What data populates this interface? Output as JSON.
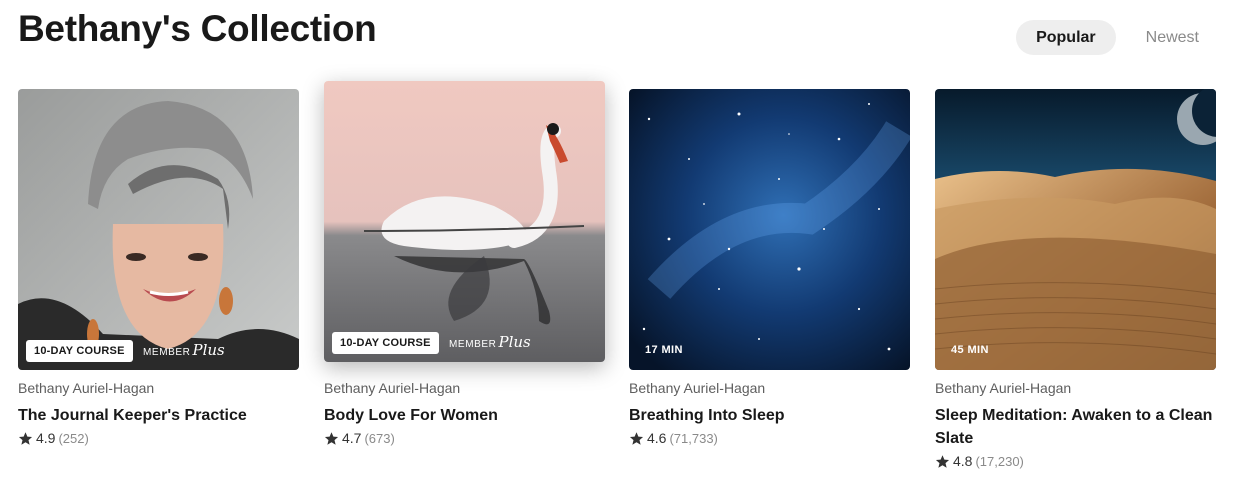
{
  "header": {
    "title": "Bethany's Collection",
    "sort_options": [
      {
        "label": "Popular",
        "active": true
      },
      {
        "label": "Newest",
        "active": false
      }
    ]
  },
  "cards": [
    {
      "badge": "10-DAY COURSE",
      "member_plus": {
        "member": "MEMBER",
        "plus": "Plus"
      },
      "author": "Bethany Auriel-Hagan",
      "title": "The Journal Keeper's Practice",
      "rating": "4.9",
      "count": "(252)"
    },
    {
      "badge": "10-DAY COURSE",
      "member_plus": {
        "member": "MEMBER",
        "plus": "Plus"
      },
      "author": "Bethany Auriel-Hagan",
      "title": "Body Love For Women",
      "rating": "4.7",
      "count": "(673)"
    },
    {
      "duration": "17 MIN",
      "author": "Bethany Auriel-Hagan",
      "title": "Breathing Into Sleep",
      "rating": "4.6",
      "count": "(71,733)"
    },
    {
      "duration": "45 MIN",
      "author": "Bethany Auriel-Hagan",
      "title": "Sleep Meditation: Awaken to a Clean Slate",
      "rating": "4.8",
      "count": "(17,230)"
    }
  ],
  "icons": {
    "rating": "star-icon"
  },
  "colors": {
    "star": "#333333",
    "active_sort_bg": "#eeeeee"
  }
}
